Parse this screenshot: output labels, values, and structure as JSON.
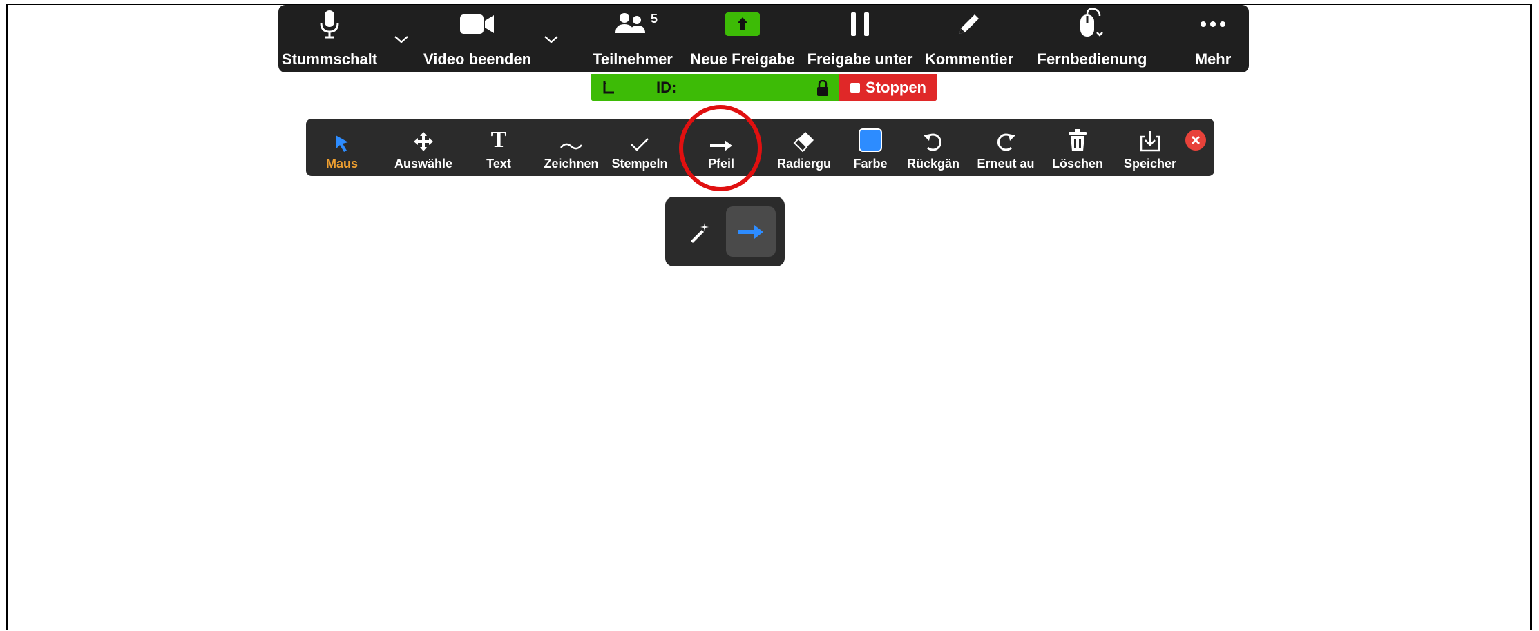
{
  "meeting_controls": {
    "mute": "Stummschalt",
    "video": "Video beenden",
    "participants": "Teilnehmer",
    "participant_count": "5",
    "new_share": "Neue Freigabe",
    "pause_share": "Freigabe unter",
    "annotate": "Kommentier",
    "remote_control": "Fernbedienung",
    "more": "Mehr"
  },
  "share_status": {
    "id_label": "ID:",
    "stop_label": "Stoppen"
  },
  "annotation_toolbar": {
    "mouse": "Maus",
    "select": "Auswähle",
    "text": "Text",
    "draw": "Zeichnen",
    "stamp": "Stempeln",
    "arrow": "Pfeil",
    "eraser": "Radiergu",
    "color": "Farbe",
    "undo": "Rückgän",
    "redo": "Erneut au",
    "clear": "Löschen",
    "save": "Speicher",
    "active_tool": "mouse",
    "selected_color": "#2d8cff",
    "text_icon_glyph": "T"
  },
  "arrow_popup": {
    "options": [
      "spotlight",
      "arrow"
    ],
    "selected": "arrow"
  },
  "colors": {
    "toolbar_bg": "#1f1f1f",
    "share_green": "#3dbb06",
    "stop_red": "#e02828",
    "accent_blue": "#2d8cff",
    "active_label": "#f0a030"
  }
}
